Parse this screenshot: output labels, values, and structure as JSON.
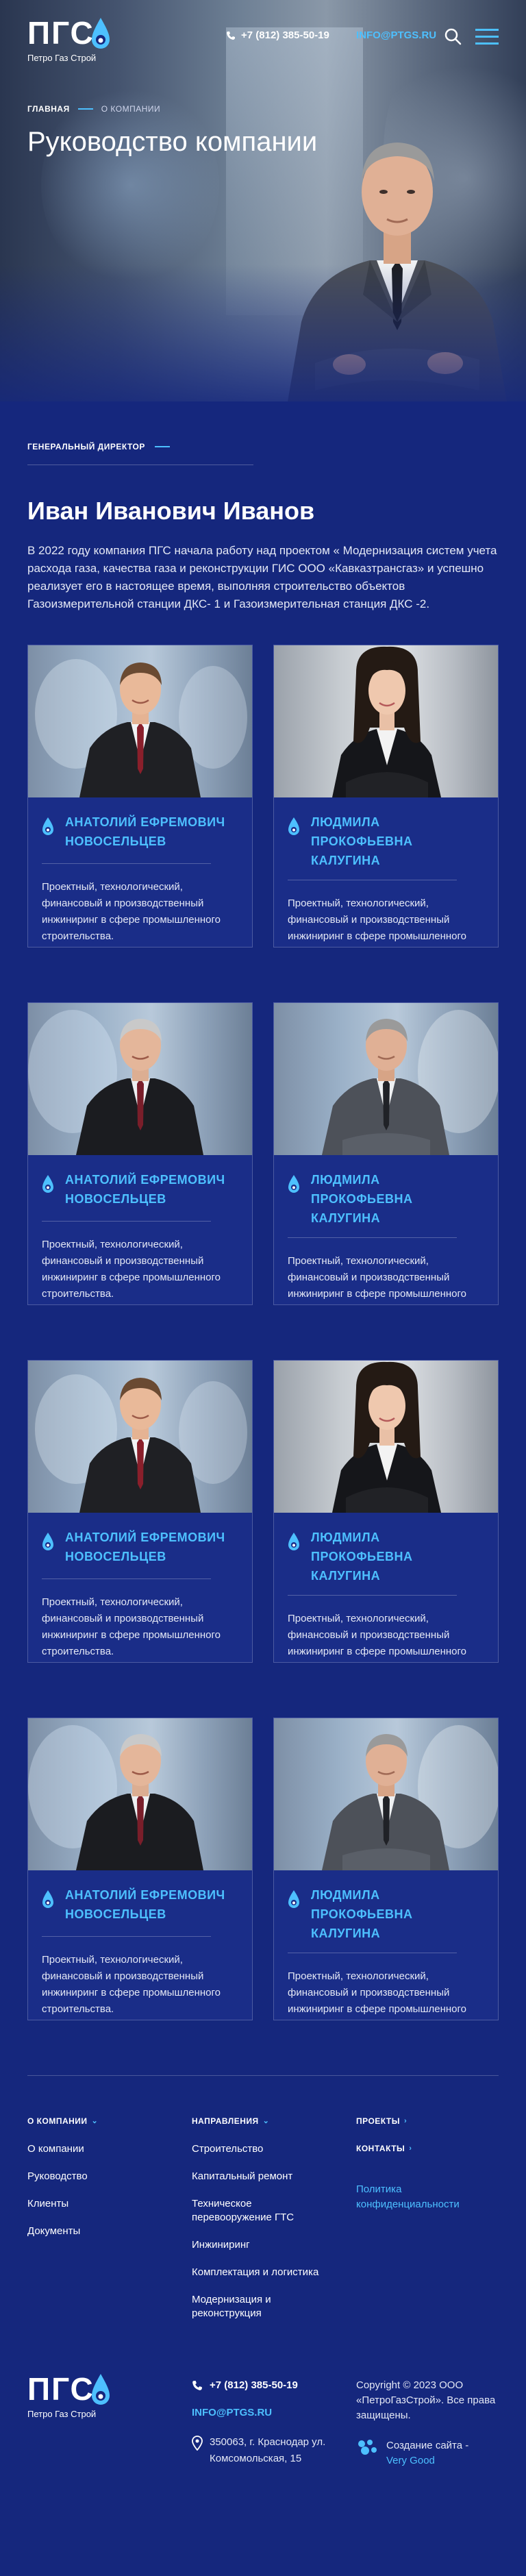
{
  "header": {
    "logo_text": "ПГС",
    "logo_sub": "Петро Газ Строй",
    "phone": "+7 (812) 385-50-19",
    "email": "INFO@PTGS.RU"
  },
  "breadcrumb": {
    "home": "ГЛАВНАЯ",
    "current": "О КОМПАНИИ"
  },
  "page_title": "Руководство компании",
  "director": {
    "label": "ГЕНЕРАЛЬНЫЙ ДИРЕКТОР",
    "name": "Иван Иванович Иванов",
    "text": "В 2022 году компания ПГС начала работу над проектом « Модернизация систем учета расхода газа, качества газа и реконструкции ГИС ООО «Кавказтрансгаз» и успешно реализует его в настоящее время, выполняя строительство объектов Газоизмерительной станции ДКС- 1 и Газоизмерительная станция ДКС -2."
  },
  "cards": [
    {
      "name1": "АНАТОЛИЙ ЕФРЕМОВИЧ",
      "name2": "НОВОСЕЛЬЦЕВ",
      "desc": "Проектный, технологический, финансовый и производственный инжиниринг в сфере промышленного строительства."
    },
    {
      "name1": "ЛЮДМИЛА ПРОКОФЬЕВНА",
      "name2": "КАЛУГИНА",
      "desc": "Проектный, технологический, финансовый и производственный инжиниринг в сфере промышленного строительства."
    },
    {
      "name1": "АНАТОЛИЙ ЕФРЕМОВИЧ",
      "name2": "НОВОСЕЛЬЦЕВ",
      "desc": "Проектный, технологический, финансовый и производственный инжиниринг в сфере промышленного строительства."
    },
    {
      "name1": "ЛЮДМИЛА ПРОКОФЬЕВНА",
      "name2": "КАЛУГИНА",
      "desc": "Проектный, технологический, финансовый и производственный инжиниринг в сфере промышленного строительства."
    },
    {
      "name1": "АНАТОЛИЙ ЕФРЕМОВИЧ",
      "name2": "НОВОСЕЛЬЦЕВ",
      "desc": "Проектный, технологический, финансовый и производственный инжиниринг в сфере промышленного строительства."
    },
    {
      "name1": "ЛЮДМИЛА ПРОКОФЬЕВНА",
      "name2": "КАЛУГИНА",
      "desc": "Проектный, технологический, финансовый и производственный инжиниринг в сфере промышленного строительства."
    },
    {
      "name1": "АНАТОЛИЙ ЕФРЕМОВИЧ",
      "name2": "НОВОСЕЛЬЦЕВ",
      "desc": "Проектный, технологический, финансовый и производственный инжиниринг в сфере промышленного строительства."
    },
    {
      "name1": "ЛЮДМИЛА ПРОКОФЬЕВНА",
      "name2": "КАЛУГИНА",
      "desc": "Проектный, технологический, финансовый и производственный инжиниринг в сфере промышленного строительства."
    }
  ],
  "footer": {
    "about": {
      "title": "О КОМПАНИИ",
      "items": [
        "О компании",
        "Руководство",
        "Клиенты",
        "Документы"
      ]
    },
    "directions": {
      "title": "НАПРАВЛЕНИЯ",
      "items": [
        "Строительство",
        "Капитальный ремонт",
        "Техническое перевооружение ГТС",
        "Инжиниринг",
        "Комплектация и логистика",
        "Модернизация и реконструкция"
      ]
    },
    "projects": "ПРОЕКТЫ",
    "contacts": "КОНТАКТЫ",
    "policy": "Политика конфиденциальности",
    "logo_text": "ПГС",
    "logo_sub": "Петро Газ Строй",
    "phone": "+7 (812) 385-50-19",
    "email": "INFO@PTGS.RU",
    "address": "350063, г. Краснодар ул. Комсомольская, 15",
    "copyright": "Copyright © 2023 ООО «ПетроГазСтрой». Все права защищены.",
    "dev_label": "Создание сайта -",
    "dev_name": "Very Good"
  },
  "colors": {
    "bg": "#15277d",
    "accent": "#4dc0ff",
    "card_bg": "#1a2d88"
  }
}
